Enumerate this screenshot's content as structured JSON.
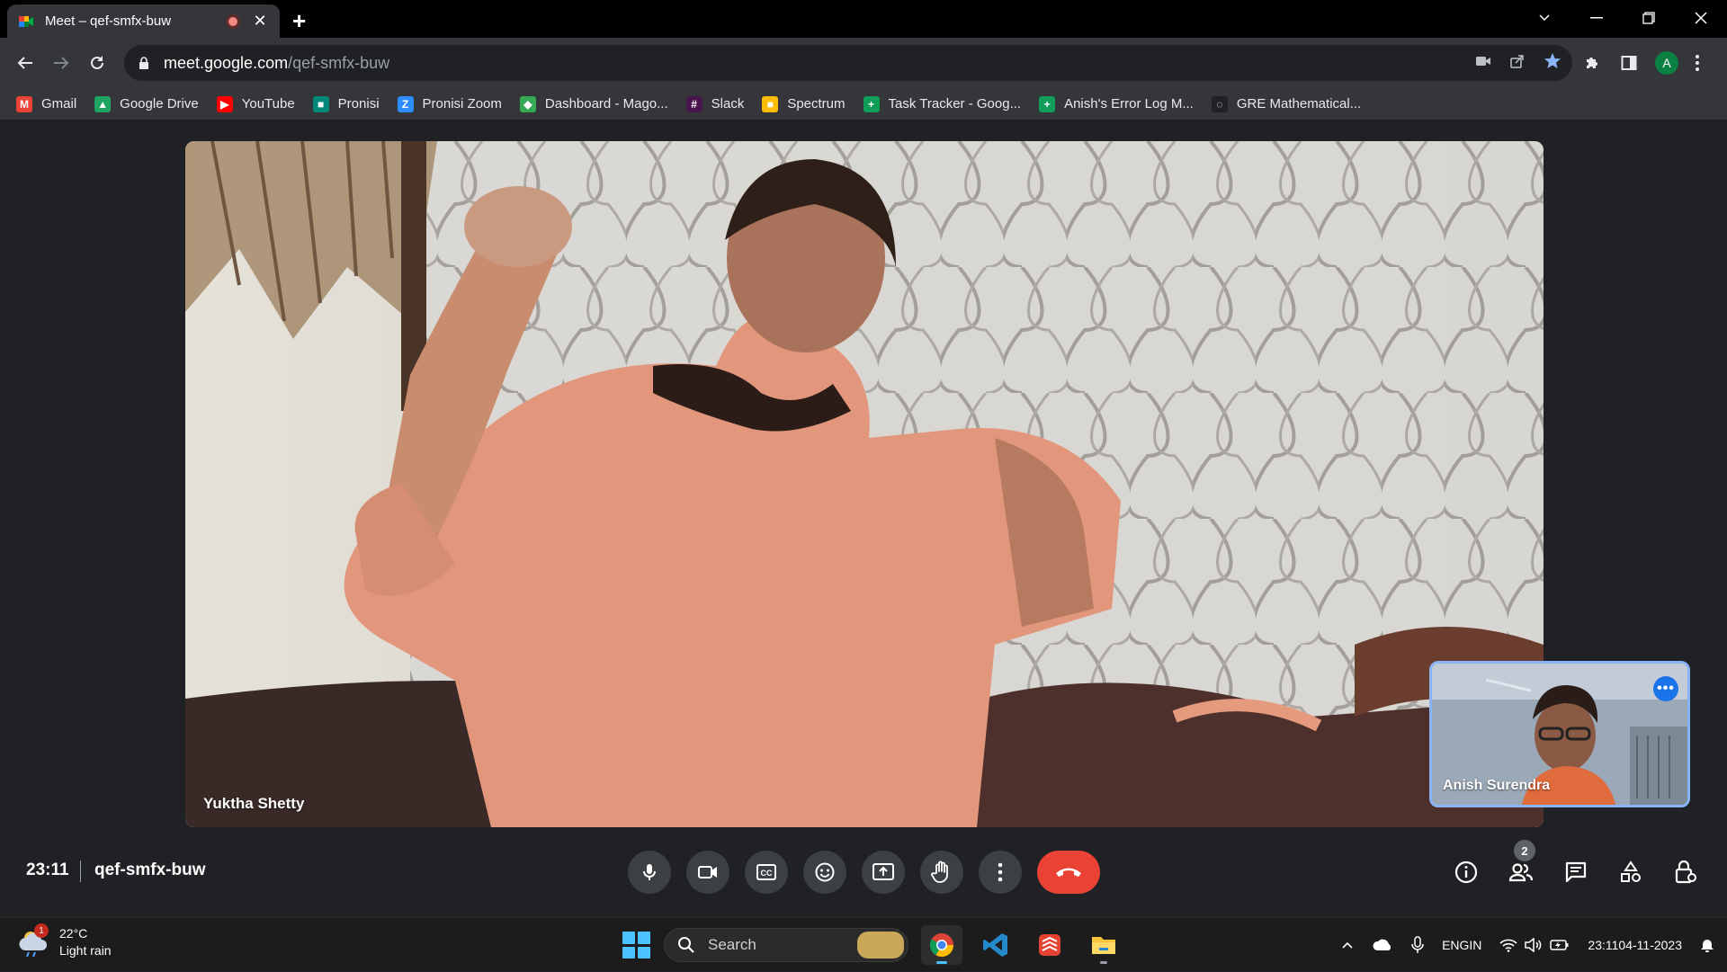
{
  "browser": {
    "tab_title": "Meet – qef-smfx-buw",
    "url_host": "meet.google.com",
    "url_path": "/qef-smfx-buw",
    "profile_initial": "A"
  },
  "bookmarks": [
    {
      "label": "Gmail",
      "icon": "gmail-icon",
      "color": "#ea4335",
      "glyph": "M"
    },
    {
      "label": "Google Drive",
      "icon": "google-drive-icon",
      "color": "#1fa463",
      "glyph": "▲"
    },
    {
      "label": "YouTube",
      "icon": "youtube-icon",
      "color": "#ff0000",
      "glyph": "▶"
    },
    {
      "label": "Pronisi",
      "icon": "meet-icon",
      "color": "#00897b",
      "glyph": "■"
    },
    {
      "label": "Pronisi Zoom",
      "icon": "zoom-icon",
      "color": "#2d8cff",
      "glyph": "Z"
    },
    {
      "label": "Dashboard - Mago...",
      "icon": "dashboard-icon",
      "color": "#34a853",
      "glyph": "◆"
    },
    {
      "label": "Slack",
      "icon": "slack-icon",
      "color": "#4a154b",
      "glyph": "#"
    },
    {
      "label": "Spectrum",
      "icon": "spectrum-icon",
      "color": "#fbbc04",
      "glyph": "■"
    },
    {
      "label": "Task Tracker - Goog...",
      "icon": "sheets-icon",
      "color": "#0f9d58",
      "glyph": "+"
    },
    {
      "label": "Anish's Error Log M...",
      "icon": "sheets-icon",
      "color": "#0f9d58",
      "glyph": "+"
    },
    {
      "label": "GRE Mathematical...",
      "icon": "loading-icon",
      "color": "#202124",
      "glyph": "◌"
    }
  ],
  "meet": {
    "main_participant": "Yuktha Shetty",
    "self_participant": "Anish Surendra",
    "time": "23:11",
    "meeting_code": "qef-smfx-buw",
    "people_count": "2"
  },
  "taskbar": {
    "weather_temp": "22°C",
    "weather_desc": "Light rain",
    "weather_badge": "1",
    "search_placeholder": "Search",
    "lang_top": "ENG",
    "lang_bottom": "IN",
    "clock_time": "23:11",
    "clock_date": "04-11-2023"
  },
  "colors": {
    "hangup": "#ea4335",
    "accent_blue": "#8ab4f8",
    "control_bg": "#3c4043"
  }
}
